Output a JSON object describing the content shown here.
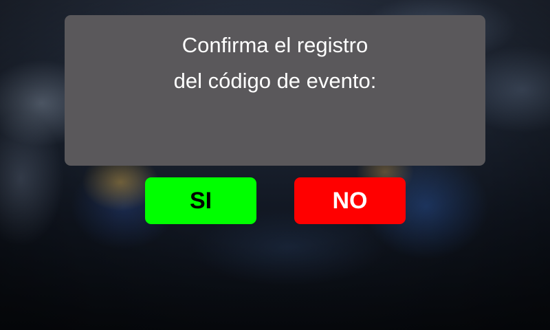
{
  "dialog": {
    "message_line1": "Confirma el registro",
    "message_line2": "del código de evento:"
  },
  "buttons": {
    "yes_label": "SI",
    "no_label": "NO"
  },
  "colors": {
    "dialog_background": "#5a585b",
    "yes_button": "#00ff00",
    "no_button": "#ff0000"
  }
}
